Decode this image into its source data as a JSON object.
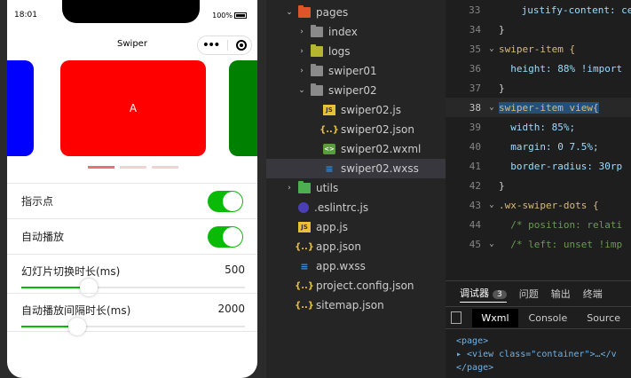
{
  "simulator": {
    "status": {
      "time": "18:01",
      "battery": "100%"
    },
    "navbar": {
      "title": "Swiper",
      "menu_icon": "ellipsis-icon",
      "close_icon": "target-icon"
    },
    "slides": [
      {
        "label": "",
        "color": "#0000ff"
      },
      {
        "label": "A",
        "color": "#ff0000"
      },
      {
        "label": "",
        "color": "#008000"
      }
    ],
    "dots": {
      "count": 3,
      "active_index": 0,
      "active_color": "#e57373",
      "inactive_color": "#f3d2d2"
    },
    "form": {
      "indicator_dots": {
        "label": "指示点",
        "checked": true
      },
      "autoplay": {
        "label": "自动播放",
        "checked": true
      },
      "duration": {
        "label": "幻灯片切换时长(ms)",
        "value": "500",
        "fraction": 0.3
      },
      "interval": {
        "label": "自动播放间隔时长(ms)",
        "value": "2000",
        "fraction": 0.25
      }
    },
    "accent": "#09bb07"
  },
  "explorer": {
    "items": [
      {
        "label": "pages",
        "type": "folder-pages",
        "expanded": true,
        "depth": 0
      },
      {
        "label": "index",
        "type": "folder",
        "expanded": false,
        "depth": 1
      },
      {
        "label": "logs",
        "type": "folder-logs",
        "expanded": false,
        "depth": 1
      },
      {
        "label": "swiper01",
        "type": "folder",
        "expanded": false,
        "depth": 1
      },
      {
        "label": "swiper02",
        "type": "folder-open",
        "expanded": true,
        "depth": 1
      },
      {
        "label": "swiper02.js",
        "type": "js",
        "depth": 2
      },
      {
        "label": "swiper02.json",
        "type": "json",
        "depth": 2
      },
      {
        "label": "swiper02.wxml",
        "type": "wxml",
        "depth": 2
      },
      {
        "label": "swiper02.wxss",
        "type": "wxss",
        "depth": 2,
        "selected": true
      },
      {
        "label": "utils",
        "type": "folder-utils",
        "expanded": false,
        "depth": 0
      },
      {
        "label": ".eslintrc.js",
        "type": "eslint",
        "depth": 0
      },
      {
        "label": "app.js",
        "type": "js",
        "depth": 0
      },
      {
        "label": "app.json",
        "type": "json",
        "depth": 0
      },
      {
        "label": "app.wxss",
        "type": "wxss",
        "depth": 0
      },
      {
        "label": "project.config.json",
        "type": "json",
        "depth": 0
      },
      {
        "label": "sitemap.json",
        "type": "json",
        "depth": 0
      }
    ]
  },
  "editor": {
    "lines": [
      {
        "n": "33",
        "fold": "",
        "text": "    justify-content: ce"
      },
      {
        "n": "34",
        "fold": "",
        "text": "}"
      },
      {
        "n": "35",
        "fold": "⌄",
        "text": "swiper-item {"
      },
      {
        "n": "36",
        "fold": "",
        "text": "  height: 88% !import"
      },
      {
        "n": "37",
        "fold": "",
        "text": "}"
      },
      {
        "n": "38",
        "fold": "⌄",
        "text": "swiper-item view{"
      },
      {
        "n": "39",
        "fold": "",
        "text": "  width: 85%;"
      },
      {
        "n": "40",
        "fold": "",
        "text": "  margin: 0 7.5%;"
      },
      {
        "n": "41",
        "fold": "",
        "text": "  border-radius: 30rp"
      },
      {
        "n": "42",
        "fold": "",
        "text": "}"
      },
      {
        "n": "43",
        "fold": "⌄",
        "text": ".wx-swiper-dots {"
      },
      {
        "n": "44",
        "fold": "",
        "text": "  /* position: relati"
      },
      {
        "n": "45",
        "fold": "⌄",
        "text": "  /* left: unset !imp"
      },
      {
        "n": "",
        "fold": "",
        "text": ""
      }
    ]
  },
  "devtools": {
    "tabs": [
      {
        "label": "调试器",
        "badge": "3",
        "active": true
      },
      {
        "label": "问题"
      },
      {
        "label": "输出"
      },
      {
        "label": "终端"
      }
    ],
    "subtabs": [
      {
        "label": "Wxml",
        "active": true
      },
      {
        "label": "Console"
      },
      {
        "label": "Source"
      }
    ],
    "dom": [
      "<page>",
      "▸ <view class=\"container\">…</v",
      "</page>"
    ]
  }
}
